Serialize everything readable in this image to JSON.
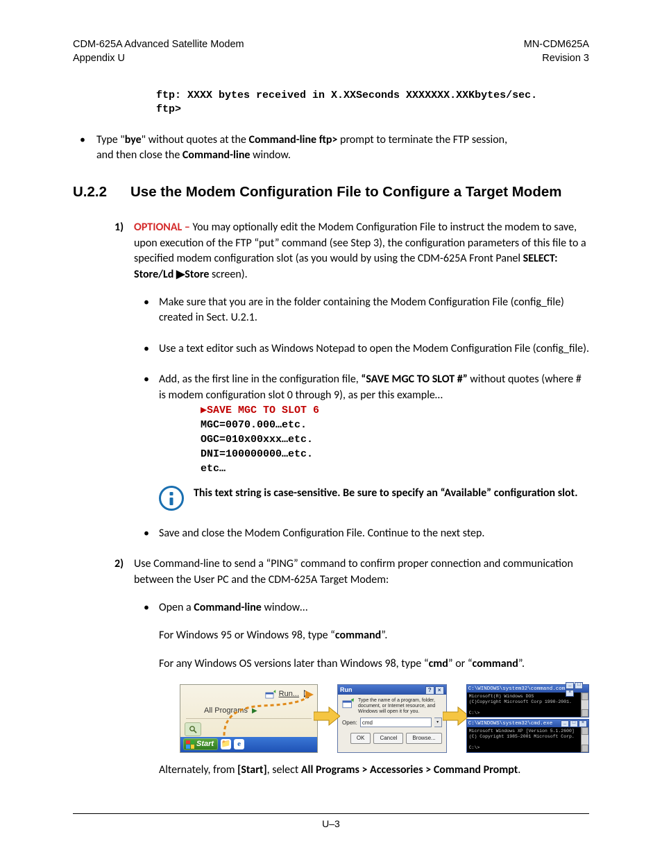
{
  "header": {
    "left1": "CDM-625A Advanced Satellite Modem",
    "left2": "Appendix U",
    "right1": "MN-CDM625A",
    "right2": "Revision 3"
  },
  "topMono": "ftp: XXXX bytes received in X.XXSeconds XXXXXXX.XXKbytes/sec.\nftp>",
  "bullet1_a": "Type \"",
  "bullet1_b": "bye",
  "bullet1_c": "\" without quotes at the ",
  "bullet1_d": "Command-line ftp>",
  "bullet1_e": " prompt to terminate the FTP session, and then close the ",
  "bullet1_f": "Command-line",
  "bullet1_g": " window.",
  "sec_num": "U.2.2",
  "sec_title": "Use  the Modem Configuration File to Configure a Target Modem",
  "step1": {
    "num": "1)",
    "opt": "OPTIONAL – ",
    "rest_a": "You may optionally edit the Modem Configuration File to instruct the modem to save, upon execution of the FTP “put” command (see Step 3), the configuration parameters of this file to a specified modem configuration slot (as you would by using the CDM-625A Front Panel ",
    "rest_b": "SELECT: Store/Ld ▶Store",
    "rest_c": " screen).",
    "sub1": "Make sure that you are in the folder containing the Modem Configuration File (config_file) created in Sect. U.2.1.",
    "sub2": "Use a text editor such as Windows Notepad to open the Modem Configuration File (config_file).",
    "sub3_a": "Add, as the first line in the configuration file, ",
    "sub3_b": "“SAVE MGC TO SLOT #”",
    "sub3_c": " without quotes (where # is modem configuration slot 0 through 9), as per this example…",
    "save_first": "▶SAVE MGC TO SLOT 6",
    "save_l2": " MGC=0070.000…etc.",
    "save_l3": " OGC=010x00xxx…etc.",
    "save_l4": " DNI=100000000…etc.",
    "save_l5": " etc…",
    "note": "This text string is case-sensitive. Be sure to specify an “Available” configuration slot.",
    "sub4": "Save and close the Modem Configuration File. Continue to the next step."
  },
  "step2": {
    "num": "2)",
    "text": "Use Command-line to send a “PING” command to confirm proper connection and communication between the User PC and the CDM-625A Target Modem:",
    "sub1_a": "Open a ",
    "sub1_b": "Command-line",
    "sub1_c": " window…",
    "p1_a": "For Windows 95 or Windows 98, type “",
    "p1_b": "command",
    "p1_c": "”.",
    "p2_a": "For any Windows OS versions later than Windows 98, type “",
    "p2_b": "cmd",
    "p2_c": "” or “",
    "p2_d": "command",
    "p2_e": "”.",
    "alt_a": "Alternately, from ",
    "alt_b": "[Start]",
    "alt_c": ", select ",
    "alt_d": "All Programs > Accessories > Command Prompt",
    "alt_e": "."
  },
  "fig": {
    "run_label": "Run...",
    "allprog_label": "All Programs",
    "start_label": "Start",
    "run_title": "Run",
    "run_msg": "Type the name of a program, folder, document, or Internet resource, and Windows will open it for you.",
    "open_label": "Open:",
    "open_value": "cmd",
    "btn_ok": "OK",
    "btn_cancel": "Cancel",
    "btn_browse": "Browse...",
    "con1_title": "C:\\WINDOWS\\system32\\command.com",
    "con1_l1": "Microsoft(R) Windows DOS",
    "con1_l2": "(C)Copyright Microsoft Corp 1990-2001.",
    "con1_l3": "C:\\>",
    "con2_title": "C:\\WINDOWS\\system32\\cmd.exe",
    "con2_l1": "Microsoft Windows XP [Version 5.1.2600]",
    "con2_l2": "(C) Copyright 1985-2001 Microsoft Corp.",
    "con2_l3": "C:\\>"
  },
  "footer": "U–3"
}
